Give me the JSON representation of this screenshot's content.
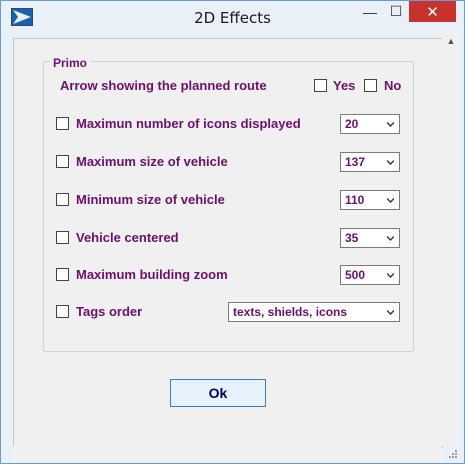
{
  "window": {
    "title": "2D Effects",
    "controls": {
      "minimize": "—",
      "maximize": "☐",
      "close": "✕"
    }
  },
  "group": {
    "title": "Primo"
  },
  "arrow_route": {
    "label": "Arrow showing the planned route",
    "yes": "Yes",
    "no": "No"
  },
  "options": [
    {
      "label": "Maximun number of icons displayed",
      "value": "20",
      "checked": false
    },
    {
      "label": "Maximum size of vehicle",
      "value": "137",
      "checked": false
    },
    {
      "label": "Minimum size of vehicle",
      "value": "110",
      "checked": false
    },
    {
      "label": "Vehicle centered",
      "value": "35",
      "checked": false
    },
    {
      "label": "Maximum building zoom",
      "value": "500",
      "checked": false
    },
    {
      "label": "Tags order",
      "value": "texts, shields, icons",
      "checked": false
    }
  ],
  "ok_button": {
    "label": "Ok"
  },
  "colors": {
    "label_text": "#6d0f6d",
    "close_button": "#c7312e",
    "title_bar": "#e9f0f8"
  },
  "icons": {
    "app": "app-icon",
    "dropdown": "chevron-down-icon"
  }
}
